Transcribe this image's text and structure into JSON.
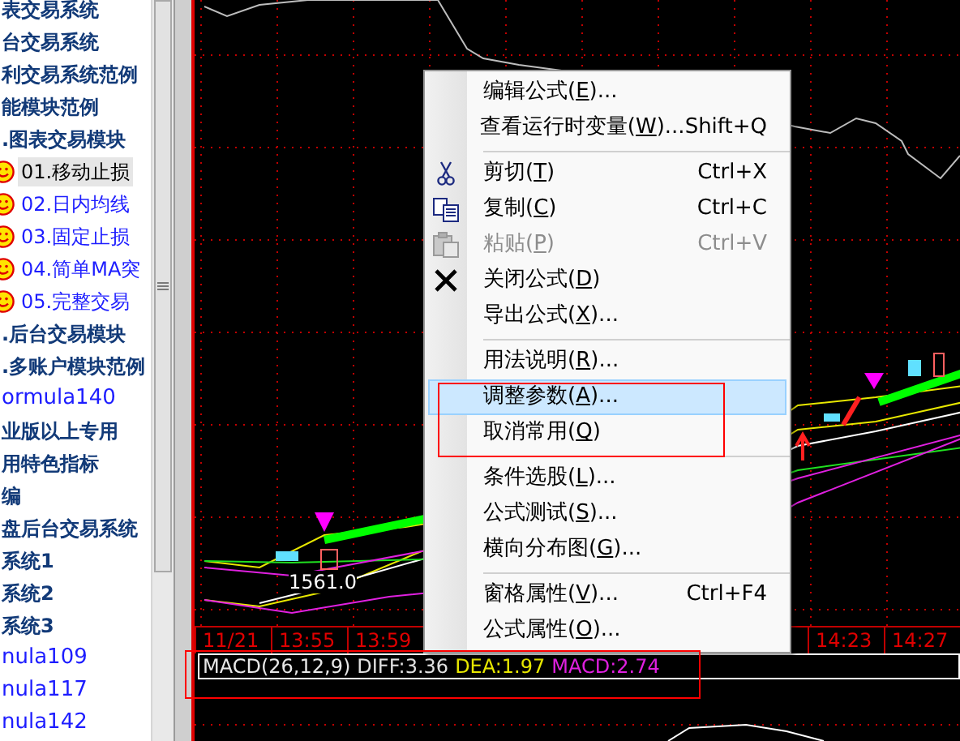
{
  "tree": {
    "items": [
      {
        "kind": "group",
        "label": "表交易系统",
        "selected": false
      },
      {
        "kind": "group",
        "label": "台交易系统",
        "selected": false
      },
      {
        "kind": "group",
        "label": "利交易系统范例",
        "selected": false
      },
      {
        "kind": "group",
        "label": "能模块范例",
        "selected": false
      },
      {
        "kind": "group",
        "label": ".图表交易模块",
        "selected": false
      },
      {
        "kind": "strategy",
        "label": "01.移动止损",
        "selected": true
      },
      {
        "kind": "strategy",
        "label": "02.日内均线",
        "selected": false
      },
      {
        "kind": "strategy",
        "label": "03.固定止损",
        "selected": false
      },
      {
        "kind": "strategy",
        "label": "04.简单MA突",
        "selected": false
      },
      {
        "kind": "strategy",
        "label": "05.完整交易",
        "selected": false
      },
      {
        "kind": "group",
        "label": ".后台交易模块",
        "selected": false
      },
      {
        "kind": "group",
        "label": ".多账户模块范例",
        "selected": false
      },
      {
        "kind": "formula",
        "label": "ormula140",
        "selected": false
      },
      {
        "kind": "group",
        "label": "业版以上专用",
        "selected": false
      },
      {
        "kind": "group",
        "label": "用特色指标",
        "selected": false
      },
      {
        "kind": "group",
        "label": "编",
        "selected": false
      },
      {
        "kind": "group",
        "label": "盘后台交易系统",
        "selected": false
      },
      {
        "kind": "group",
        "label": "系统1",
        "selected": false
      },
      {
        "kind": "group",
        "label": "系统2",
        "selected": false
      },
      {
        "kind": "group",
        "label": "系统3",
        "selected": false
      },
      {
        "kind": "formula",
        "label": "nula109",
        "selected": false
      },
      {
        "kind": "formula",
        "label": "nula117",
        "selected": false
      },
      {
        "kind": "formula",
        "label": "nula142",
        "selected": false
      }
    ]
  },
  "chart": {
    "price_label": "1561.0",
    "time_axis": {
      "left": [
        "11/21",
        "13:55",
        "13:59"
      ],
      "right": [
        "14:23",
        "14:27"
      ]
    },
    "indicator": {
      "name": "MACD(26,12,9)",
      "values": [
        {
          "text": "DIFF:3.36",
          "color": "#e0e0e0"
        },
        {
          "text": "DEA:1.97",
          "color": "#e8e800"
        },
        {
          "text": "MACD:2.74",
          "color": "#e020e0"
        }
      ]
    }
  },
  "context_menu": {
    "items": [
      {
        "kind": "item",
        "before": "编辑公式(",
        "key": "E",
        "after": ")...",
        "disabled": false,
        "selected": false
      },
      {
        "kind": "item",
        "before": "查看运行时变量(",
        "key": "W",
        "after": ")...",
        "shortcut": "Shift+Q",
        "disabled": false,
        "selected": false
      },
      {
        "kind": "separator"
      },
      {
        "kind": "item",
        "before": "剪切(",
        "key": "T",
        "after": ")",
        "shortcut": "Ctrl+X",
        "disabled": false,
        "selected": false
      },
      {
        "kind": "item",
        "before": "复制(",
        "key": "C",
        "after": ")",
        "shortcut": "Ctrl+C",
        "disabled": false,
        "selected": false
      },
      {
        "kind": "item",
        "before": "粘贴(",
        "key": "P",
        "after": ")",
        "shortcut": "Ctrl+V",
        "disabled": true,
        "selected": false
      },
      {
        "kind": "item",
        "before": "关闭公式(",
        "key": "D",
        "after": ")",
        "disabled": false,
        "selected": false
      },
      {
        "kind": "item",
        "before": "导出公式(",
        "key": "X",
        "after": ")...",
        "disabled": false,
        "selected": false
      },
      {
        "kind": "separator"
      },
      {
        "kind": "item",
        "before": "用法说明(",
        "key": "R",
        "after": ")...",
        "disabled": false,
        "selected": false
      },
      {
        "kind": "item",
        "before": "调整参数(",
        "key": "A",
        "after": ")...",
        "disabled": false,
        "selected": true
      },
      {
        "kind": "item",
        "before": "取消常用(",
        "key": "Q",
        "after": ")",
        "disabled": false,
        "selected": false
      },
      {
        "kind": "separator"
      },
      {
        "kind": "item",
        "before": "条件选股(",
        "key": "L",
        "after": ")...",
        "disabled": false,
        "selected": false
      },
      {
        "kind": "item",
        "before": "公式测试(",
        "key": "S",
        "after": ")...",
        "disabled": false,
        "selected": false
      },
      {
        "kind": "item",
        "before": "横向分布图(",
        "key": "G",
        "after": ")...",
        "disabled": false,
        "selected": false
      },
      {
        "kind": "separator"
      },
      {
        "kind": "item",
        "before": "窗格属性(",
        "key": "V",
        "after": ")...",
        "shortcut": "Ctrl+F4",
        "disabled": false,
        "selected": false
      },
      {
        "kind": "item",
        "before": "公式属性(",
        "key": "O",
        "after": ")...",
        "disabled": false,
        "selected": false
      }
    ]
  }
}
